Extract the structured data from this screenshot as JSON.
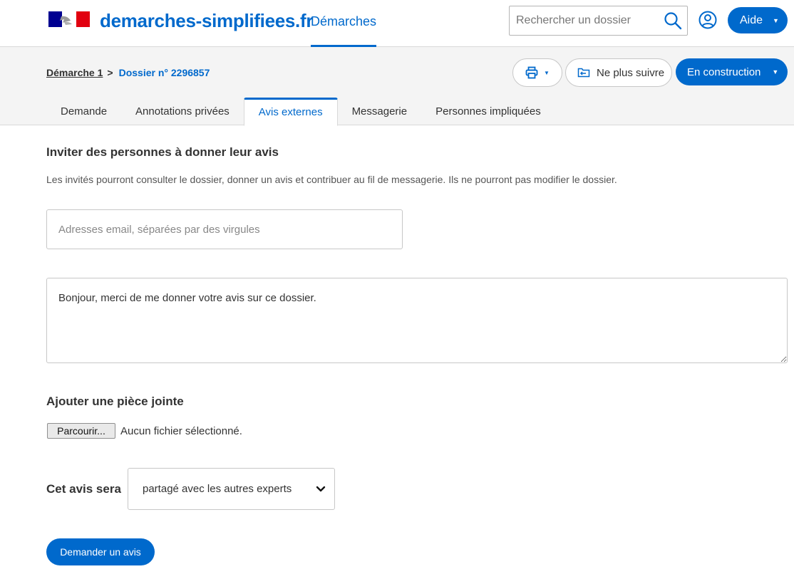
{
  "header": {
    "brand": "demarches-simplifiees.fr",
    "nav_demarches": "Démarches",
    "search": {
      "placeholder": "Rechercher un dossier",
      "value": ""
    },
    "aide_label": "Aide"
  },
  "subheader": {
    "breadcrumb": {
      "procedure": "Démarche 1",
      "separator": ">",
      "dossier": "Dossier n° 2296857"
    },
    "unfollow_label": "Ne plus suivre",
    "status_label": "En construction"
  },
  "tabs": [
    {
      "label": "Demande"
    },
    {
      "label": "Annotations privées"
    },
    {
      "label": "Avis externes"
    },
    {
      "label": "Messagerie"
    },
    {
      "label": "Personnes impliquées"
    }
  ],
  "invite": {
    "title": "Inviter des personnes à donner leur avis",
    "description": "Les invités pourront consulter le dossier, donner un avis et contribuer au fil de messagerie. Ils ne pourront pas modifier le dossier.",
    "emails": {
      "placeholder": "Adresses email, séparées par des virgules",
      "value": ""
    },
    "message": "Bonjour, merci de me donner votre avis sur ce dossier."
  },
  "attachment": {
    "title": "Ajouter une pièce jointe",
    "browse_label": "Parcourir...",
    "status": "Aucun fichier sélectionné."
  },
  "visibility": {
    "label": "Cet avis sera",
    "selected": "partagé avec les autres experts"
  },
  "submit_label": "Demander un avis",
  "colors": {
    "primary": "#0069cc",
    "flag_blue": "#000091",
    "flag_red": "#e1000f"
  },
  "icons": [
    "marianne-logo",
    "search-icon",
    "user-account-icon",
    "printer-icon",
    "unfollow-folder-icon",
    "chevron-down-icon"
  ]
}
